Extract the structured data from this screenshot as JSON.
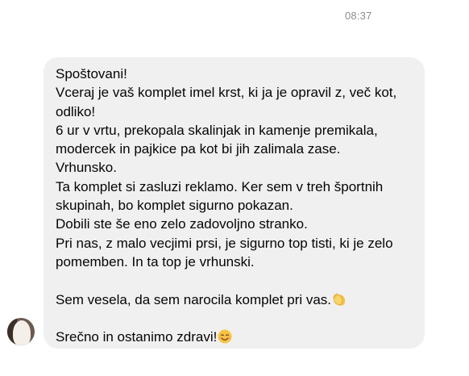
{
  "chat": {
    "timestamp": "08:37",
    "message": {
      "lines": [
        "Spoštovani!",
        "Vceraj je vaš komplet imel krst, ki ja je opravil z, več kot,",
        "odliko!",
        "6 ur v vrtu, prekopala skalinjak in kamenje premikala,",
        "modercek in pajkice pa kot bi jih zalimala zase.",
        "Vrhunsko.",
        "Ta komplet si zasluzi reklamo. Ker sem v treh športnih",
        "skupinah, bo komplet sigurno pokazan.",
        "Dobili ste še eno zelo zadovoljno stranko.",
        "Pri nas, z malo vecjimi prsi, je sigurno top tisti, ki je zelo",
        "pomemben. In ta top je vrhunski."
      ],
      "closing_line_1": "Sem vesela, da sem narocila komplet pri vas.",
      "closing_line_2": "Srečno in ostanimo zdravi!"
    },
    "emojis": [
      "clapping-hands-icon",
      "smiling-face-icon"
    ],
    "colors": {
      "bubble": "#f0f0f0",
      "text": "#050505",
      "timestamp": "#8a8d91"
    }
  }
}
